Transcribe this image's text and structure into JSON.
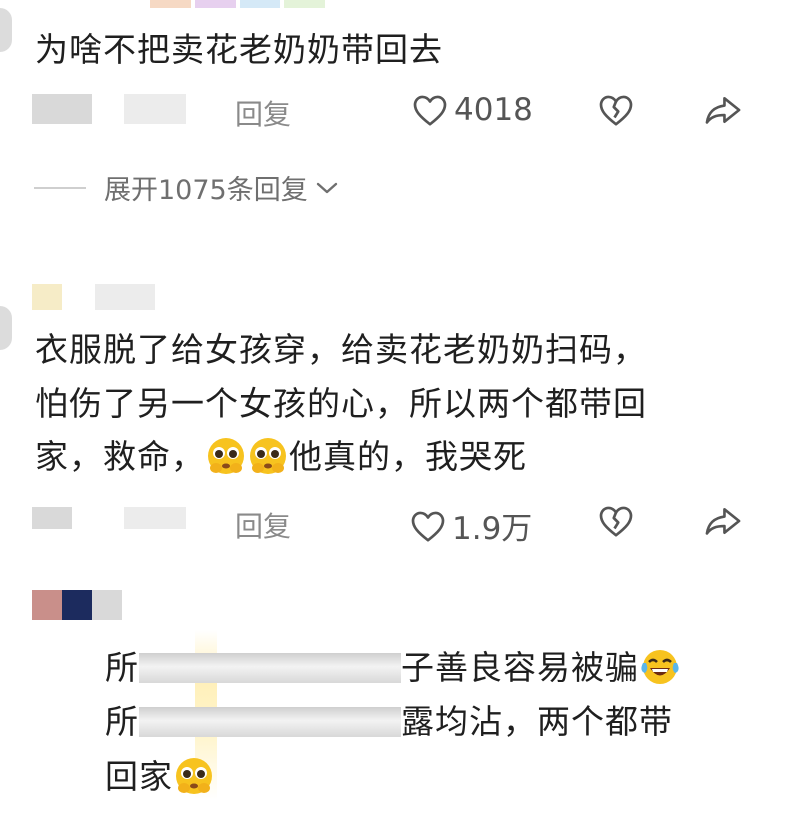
{
  "comment1": {
    "text": "为啥不把卖花老奶奶带回去",
    "reply_label": "回复",
    "like_count": "4018",
    "expand_label": "展开1075条回复"
  },
  "comment2": {
    "line1": "衣服脱了给女孩穿，给卖花老奶奶扫码，",
    "line2": "怕伤了另一个女孩的心，所以两个都带回",
    "line3_a": "家，救命，",
    "line3_b": "他真的，我哭死",
    "reply_label": "回复",
    "like_count": "1.9万"
  },
  "reply1": {
    "line1_a": "所",
    "line1_b": "子善良容易被骗",
    "line2_a": "所",
    "line2_b": "露均沾，两个都带",
    "line3": "回家"
  },
  "colors": {
    "text": "#1f1f1f",
    "meta": "#8a8a8a",
    "icon": "#555555",
    "emoji_face": "#f7c31f",
    "avatar_pink": "#c98f8a",
    "avatar_navy": "#1c2b5e",
    "avatar_cream": "#f6ecc7"
  },
  "icons": [
    "heart-icon",
    "dislike-heart-icon",
    "share-icon",
    "chevron-down-icon",
    "pleading-face-emoji",
    "laugh-cry-emoji"
  ]
}
